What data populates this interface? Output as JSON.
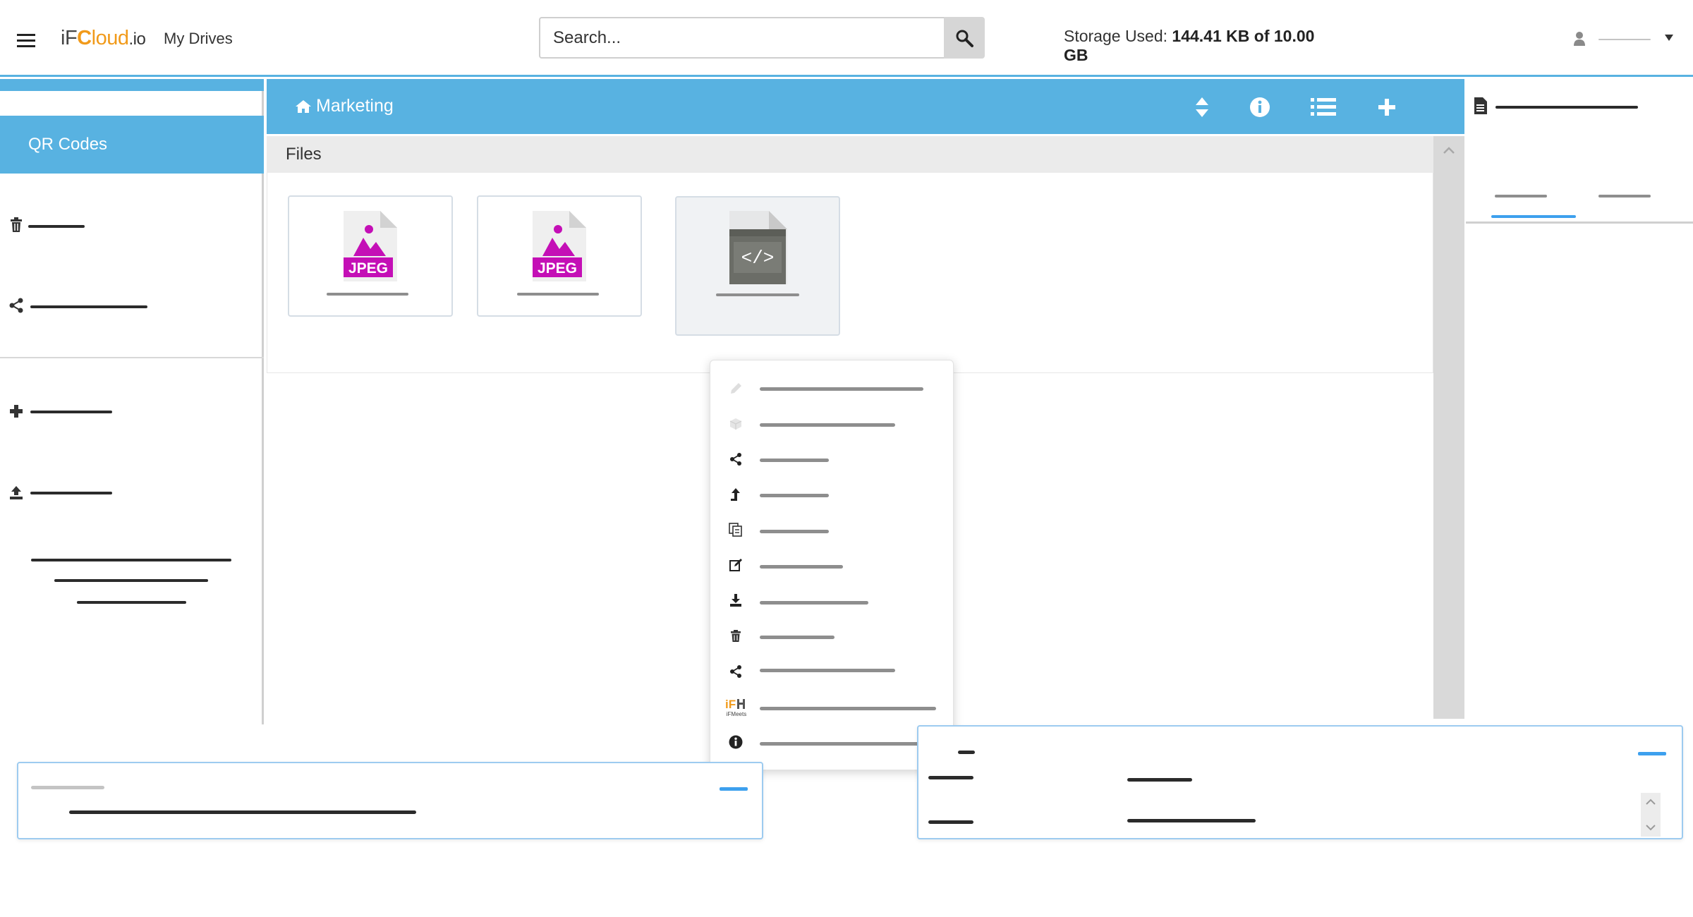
{
  "header": {
    "logo": {
      "prefix": "iF",
      "c": "C",
      "suffix": "loud",
      "tld": ".io"
    },
    "my_drives": "My Drives",
    "search_placeholder": "Search...",
    "storage": {
      "label": "Storage Used: ",
      "value": "144.41 KB of 10.00",
      "value2": "GB"
    }
  },
  "sidebar": {
    "active_item": "QR Codes",
    "items": [
      {
        "icon": "trash-icon"
      },
      {
        "icon": "share-icon"
      },
      {
        "icon": "plus-icon"
      },
      {
        "icon": "upload-icon"
      }
    ]
  },
  "main": {
    "breadcrumb": "Marketing",
    "toolbar_icons": [
      "sort-icon",
      "info-icon",
      "list-view-icon",
      "add-icon"
    ],
    "section_title": "Files",
    "files": [
      {
        "type_label": "JPEG",
        "icon": "jpeg-file-icon",
        "color": "#c40fb6"
      },
      {
        "type_label": "JPEG",
        "icon": "jpeg-file-icon",
        "color": "#c40fb6"
      },
      {
        "type_label": "</>",
        "icon": "code-file-icon",
        "color": "#6b6d67"
      }
    ]
  },
  "context_menu": {
    "items": [
      {
        "icon": "pencil-icon",
        "disabled": true
      },
      {
        "icon": "box-icon",
        "disabled": true
      },
      {
        "icon": "share-icon"
      },
      {
        "icon": "move-icon"
      },
      {
        "icon": "copy-icon"
      },
      {
        "icon": "edit-icon"
      },
      {
        "icon": "download-icon"
      },
      {
        "icon": "trash-icon"
      },
      {
        "icon": "share-link-icon"
      },
      {
        "icon": "ifmeets-icon",
        "label": "iFMeets"
      },
      {
        "icon": "info-icon"
      }
    ]
  },
  "colors": {
    "accent": "#58b2e1",
    "jpeg": "#c40fb6",
    "code": "#6b6d67",
    "ifmeets": "#f19a1a"
  }
}
